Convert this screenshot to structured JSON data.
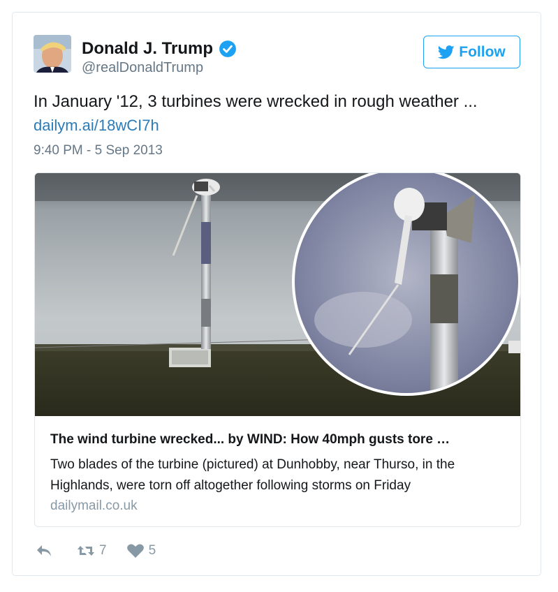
{
  "author": {
    "name": "Donald J. Trump",
    "handle": "@realDonaldTrump",
    "verified_icon": "verified-badge-icon"
  },
  "follow_button": {
    "label": "Follow",
    "icon": "twitter-bird-icon",
    "color": "#1da1f2"
  },
  "tweet": {
    "text": "In January '12, 3 turbines were wrecked in rough weather ...",
    "link": "dailym.ai/18wCI7h",
    "timestamp": "9:40 PM - 5 Sep 2013"
  },
  "card": {
    "image": "wind-turbine-photo",
    "title": "The wind turbine wrecked... by WIND: How 40mph gusts tore …",
    "description": "Two blades of the turbine (pictured) at Dunhobby, near Thurso, in the Highlands, were torn off altogether following storms on Friday",
    "domain": "dailymail.co.uk"
  },
  "actions": {
    "reply_icon": "reply-icon",
    "retweet_icon": "retweet-icon",
    "retweet_count": "7",
    "like_icon": "heart-icon",
    "like_count": "5"
  },
  "colors": {
    "link": "#2b7bb9",
    "muted": "#657786",
    "accent": "#1da1f2"
  }
}
